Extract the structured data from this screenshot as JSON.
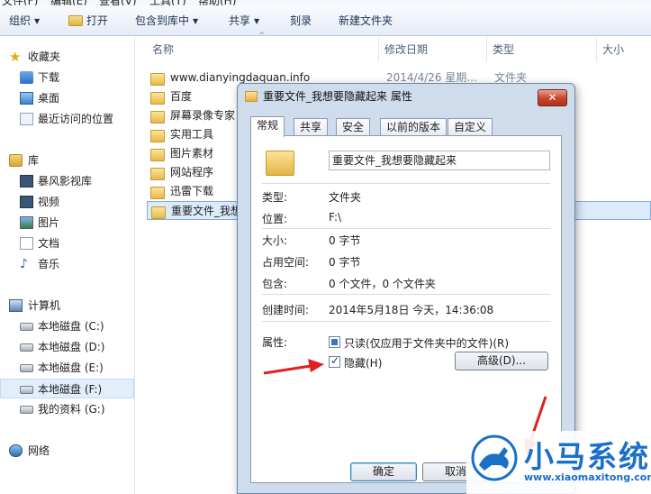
{
  "menubar": {
    "items": [
      "文件(F)",
      "编辑(E)",
      "查看(V)",
      "工具(T)",
      "帮助(H)"
    ]
  },
  "toolbar": {
    "organize": "组织",
    "open": "打开",
    "include_in_library": "包含到库中",
    "share": "共享",
    "burn": "刻录",
    "new_folder": "新建文件夹"
  },
  "nav": {
    "favorites": "收藏夹",
    "downloads": "下载",
    "desktop": "桌面",
    "recent": "最近访问的位置",
    "libraries": "库",
    "storm": "暴风影视库",
    "videos": "视频",
    "pictures": "图片",
    "documents": "文档",
    "music": "音乐",
    "computer": "计算机",
    "disk_c": "本地磁盘 (C:)",
    "disk_d": "本地磁盘 (D:)",
    "disk_e": "本地磁盘 (E:)",
    "disk_f": "本地磁盘 (F:)",
    "disk_g": "我的资料 (G:)",
    "network": "网络"
  },
  "columns": {
    "name": "名称",
    "date": "修改日期",
    "type": "类型",
    "size": "大小"
  },
  "files": [
    {
      "name": "www.dianyingdaquan.info",
      "date": "2014/4/26 星期...",
      "type": "文件夹"
    },
    {
      "name": "百度"
    },
    {
      "name": "屏幕录像专家"
    },
    {
      "name": "实用工具"
    },
    {
      "name": "图片素材"
    },
    {
      "name": "网站程序"
    },
    {
      "name": "迅雷下载"
    },
    {
      "name": "重要文件_我想"
    }
  ],
  "dialog": {
    "title": "重要文件_我想要隐藏起来 属性",
    "close": "✕",
    "tabs": [
      "常规",
      "共享",
      "安全",
      "以前的版本",
      "自定义"
    ],
    "folder_name": "重要文件_我想要隐藏起来",
    "type_label": "类型:",
    "type_value": "文件夹",
    "location_label": "位置:",
    "location_value": "F:\\",
    "size_label": "大小:",
    "size_value": "0 字节",
    "disk_size_label": "占用空间:",
    "disk_size_value": "0 字节",
    "contains_label": "包含:",
    "contains_value": "0 个文件，0 个文件夹",
    "created_label": "创建时间:",
    "created_value": "2014年5月18日  今天，14:36:08",
    "attributes_label": "属性:",
    "readonly_label": "只读(仅应用于文件夹中的文件)(R)",
    "hidden_label": "隐藏(H)",
    "advanced_button": "高级(D)...",
    "ok_button": "确定",
    "cancel_button": "取消"
  },
  "watermark": {
    "name": "小马系统",
    "url": "www.xiaomaxitong.com"
  },
  "colors": {
    "arrow": "#e02020",
    "brand": "#1a6fc8"
  }
}
